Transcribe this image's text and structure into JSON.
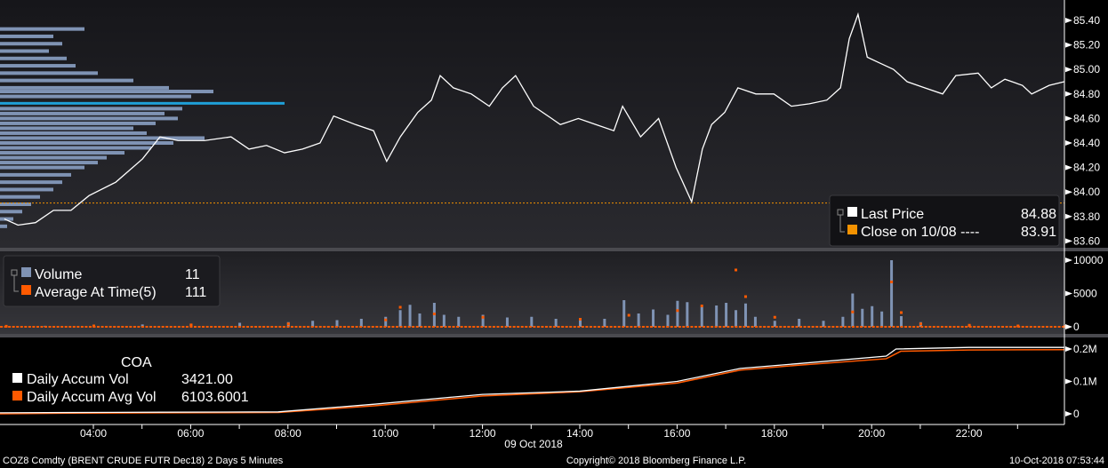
{
  "chart_data": [
    {
      "type": "line",
      "title": "Price",
      "yaxis_ticks": [
        "85.40",
        "85.20",
        "85.00",
        "84.80",
        "84.60",
        "84.40",
        "84.20",
        "84.00",
        "83.80",
        "83.60"
      ],
      "ylim": [
        83.55,
        85.57
      ],
      "legend": {
        "last_price_label": "Last Price",
        "last_price_value": "84.88",
        "close_label": "Close on 10/08 ----",
        "close_value": "83.91"
      },
      "close_line": 83.91,
      "volume_profile_peak": 84.72,
      "series": [
        {
          "name": "Last Price",
          "color": "#ffffff",
          "points": [
            [
              2.17,
              83.78
            ],
            [
              2.45,
              83.73
            ],
            [
              2.81,
              83.75
            ],
            [
              3.18,
              83.85
            ],
            [
              3.54,
              83.85
            ],
            [
              3.91,
              83.97
            ],
            [
              4.46,
              84.08
            ],
            [
              5.01,
              84.27
            ],
            [
              5.37,
              84.45
            ],
            [
              5.74,
              84.42
            ],
            [
              6.29,
              84.42
            ],
            [
              6.83,
              84.45
            ],
            [
              7.2,
              84.35
            ],
            [
              7.56,
              84.38
            ],
            [
              7.93,
              84.32
            ],
            [
              8.3,
              84.35
            ],
            [
              8.66,
              84.4
            ],
            [
              8.94,
              84.62
            ],
            [
              9.39,
              84.55
            ],
            [
              9.76,
              84.5
            ],
            [
              10.03,
              84.25
            ],
            [
              10.31,
              84.45
            ],
            [
              10.67,
              84.65
            ],
            [
              10.95,
              84.75
            ],
            [
              11.13,
              84.95
            ],
            [
              11.4,
              84.85
            ],
            [
              11.77,
              84.8
            ],
            [
              12.14,
              84.7
            ],
            [
              12.41,
              84.85
            ],
            [
              12.68,
              84.95
            ],
            [
              13.05,
              84.7
            ],
            [
              13.42,
              84.6
            ],
            [
              13.6,
              84.55
            ],
            [
              13.97,
              84.6
            ],
            [
              14.33,
              84.55
            ],
            [
              14.7,
              84.5
            ],
            [
              14.88,
              84.7
            ],
            [
              15.25,
              84.45
            ],
            [
              15.62,
              84.6
            ],
            [
              15.98,
              84.2
            ],
            [
              16.3,
              83.92
            ],
            [
              16.52,
              84.35
            ],
            [
              16.71,
              84.55
            ],
            [
              16.98,
              84.65
            ],
            [
              17.25,
              84.85
            ],
            [
              17.62,
              84.8
            ],
            [
              17.99,
              84.8
            ],
            [
              18.35,
              84.7
            ],
            [
              18.72,
              84.72
            ],
            [
              19.08,
              84.75
            ],
            [
              19.36,
              84.85
            ],
            [
              19.54,
              85.25
            ],
            [
              19.72,
              85.45
            ],
            [
              19.91,
              85.1
            ],
            [
              20.18,
              85.05
            ],
            [
              20.45,
              85.0
            ],
            [
              20.73,
              84.9
            ],
            [
              21.09,
              84.85
            ],
            [
              21.46,
              84.8
            ],
            [
              21.73,
              84.95
            ],
            [
              22.19,
              84.97
            ],
            [
              22.46,
              84.85
            ],
            [
              22.74,
              84.92
            ],
            [
              23.1,
              84.87
            ],
            [
              23.29,
              84.8
            ],
            [
              23.65,
              84.87
            ],
            [
              23.96,
              84.9
            ]
          ]
        }
      ],
      "volume_profile": [
        [
          85.33,
          95
        ],
        [
          85.27,
          60
        ],
        [
          85.21,
          70
        ],
        [
          85.15,
          55
        ],
        [
          85.09,
          75
        ],
        [
          85.03,
          85
        ],
        [
          84.97,
          110
        ],
        [
          84.91,
          150
        ],
        [
          84.85,
          190
        ],
        [
          84.82,
          240
        ],
        [
          84.78,
          215
        ],
        [
          84.72,
          320
        ],
        [
          84.68,
          205
        ],
        [
          84.64,
          185
        ],
        [
          84.6,
          200
        ],
        [
          84.56,
          175
        ],
        [
          84.52,
          150
        ],
        [
          84.48,
          165
        ],
        [
          84.44,
          230
        ],
        [
          84.4,
          195
        ],
        [
          84.36,
          170
        ],
        [
          84.32,
          140
        ],
        [
          84.28,
          120
        ],
        [
          84.24,
          110
        ],
        [
          84.2,
          95
        ],
        [
          84.14,
          80
        ],
        [
          84.08,
          70
        ],
        [
          84.02,
          60
        ],
        [
          83.96,
          45
        ],
        [
          83.9,
          35
        ],
        [
          83.84,
          25
        ],
        [
          83.78,
          15
        ],
        [
          83.72,
          8
        ]
      ]
    },
    {
      "type": "bar",
      "title": "Volume",
      "yaxis_ticks": [
        "10000",
        "5000",
        "0"
      ],
      "ylim": [
        0,
        10000
      ],
      "legend": {
        "volume_label": "Volume",
        "volume_value": "11",
        "avg_label": "Average At Time(5)",
        "avg_value": "111"
      },
      "series": [
        {
          "name": "Volume",
          "color": "#7f93b4",
          "points": [
            [
              2.2,
              100
            ],
            [
              3,
              150
            ],
            [
              4,
              300
            ],
            [
              5,
              350
            ],
            [
              6,
              450
            ],
            [
              7,
              600
            ],
            [
              8,
              700
            ],
            [
              8.5,
              900
            ],
            [
              9,
              1000
            ],
            [
              9.5,
              1200
            ],
            [
              10,
              1500
            ],
            [
              10.3,
              2500
            ],
            [
              10.5,
              3300
            ],
            [
              10.7,
              2000
            ],
            [
              11,
              3600
            ],
            [
              11.2,
              1800
            ],
            [
              11.5,
              1500
            ],
            [
              12,
              1800
            ],
            [
              12.5,
              1400
            ],
            [
              13,
              1500
            ],
            [
              13.5,
              1200
            ],
            [
              14,
              1100
            ],
            [
              14.5,
              1200
            ],
            [
              14.9,
              4000
            ],
            [
              15.2,
              2000
            ],
            [
              15.5,
              2600
            ],
            [
              15.8,
              1800
            ],
            [
              16,
              3900
            ],
            [
              16.2,
              3700
            ],
            [
              16.5,
              3000
            ],
            [
              16.8,
              3200
            ],
            [
              17,
              3600
            ],
            [
              17.2,
              2500
            ],
            [
              17.4,
              3500
            ],
            [
              17.6,
              1500
            ],
            [
              18,
              900
            ],
            [
              18.5,
              1200
            ],
            [
              19,
              900
            ],
            [
              19.4,
              1500
            ],
            [
              19.6,
              5000
            ],
            [
              19.8,
              2700
            ],
            [
              20,
              3100
            ],
            [
              20.2,
              2300
            ],
            [
              20.4,
              10000
            ],
            [
              20.6,
              1600
            ],
            [
              21,
              700
            ],
            [
              22,
              300
            ],
            [
              23,
              200
            ],
            [
              23.96,
              11
            ]
          ]
        },
        {
          "name": "Average At Time(5)",
          "color": "#ff5a00",
          "points": [
            [
              2.2,
              150
            ],
            [
              4,
              200
            ],
            [
              6,
              350
            ],
            [
              8,
              500
            ],
            [
              10,
              1100
            ],
            [
              10.3,
              3000
            ],
            [
              11,
              2000
            ],
            [
              12,
              1500
            ],
            [
              14,
              1200
            ],
            [
              15,
              1800
            ],
            [
              16,
              2500
            ],
            [
              16.5,
              3200
            ],
            [
              17.2,
              8600
            ],
            [
              17.4,
              4600
            ],
            [
              18,
              1500
            ],
            [
              19.6,
              2300
            ],
            [
              20.4,
              6800
            ],
            [
              20.6,
              2200
            ],
            [
              21,
              500
            ],
            [
              22,
              300
            ],
            [
              23,
              200
            ],
            [
              23.96,
              111
            ]
          ]
        }
      ]
    },
    {
      "type": "line",
      "title": "COA",
      "yaxis_ticks": [
        "0.2M",
        "0.1M",
        "0"
      ],
      "ylim": [
        0,
        0.2
      ],
      "legend": {
        "vol_label": "Daily Accum Vol",
        "vol_value": "3421.00",
        "avg_label": "Daily Accum Avg Vol",
        "avg_value": "6103.6001"
      },
      "series": [
        {
          "name": "Daily Accum Vol",
          "color": "#ffffff",
          "points": [
            [
              2.08,
              0.003
            ],
            [
              3.5,
              0.004
            ],
            [
              5.4,
              0.005
            ],
            [
              7.8,
              0.006
            ],
            [
              9.8,
              0.03
            ],
            [
              12,
              0.06
            ],
            [
              14,
              0.07
            ],
            [
              16,
              0.1
            ],
            [
              17.3,
              0.14
            ],
            [
              18.5,
              0.155
            ],
            [
              20.3,
              0.178
            ],
            [
              20.5,
              0.2
            ],
            [
              22,
              0.205
            ],
            [
              23.96,
              0.205
            ]
          ]
        },
        {
          "name": "Daily Accum Avg Vol",
          "color": "#ff5a00",
          "points": [
            [
              2.08,
              0.0
            ],
            [
              3.5,
              0.002
            ],
            [
              5.4,
              0.003
            ],
            [
              7.8,
              0.004
            ],
            [
              9.8,
              0.025
            ],
            [
              12,
              0.055
            ],
            [
              14,
              0.068
            ],
            [
              16,
              0.095
            ],
            [
              17.3,
              0.135
            ],
            [
              18.5,
              0.15
            ],
            [
              20.3,
              0.17
            ],
            [
              20.6,
              0.193
            ],
            [
              22,
              0.197
            ],
            [
              23.96,
              0.198
            ]
          ]
        }
      ]
    }
  ],
  "xaxis": {
    "ticks": [
      [
        "04:00",
        4
      ],
      [
        "06:00",
        6
      ],
      [
        "08:00",
        8
      ],
      [
        "10:00",
        10
      ],
      [
        "12:00",
        12
      ],
      [
        "14:00",
        14
      ],
      [
        "16:00",
        16
      ],
      [
        "18:00",
        18
      ],
      [
        "20:00",
        20
      ],
      [
        "22:00",
        22
      ]
    ],
    "date_label": "09 Oct 2018"
  },
  "footer": {
    "security": "COZ8 Comdty (BRENT CRUDE FUTR  Dec18) 2 Days 5 Minutes",
    "copyright": "Copyright© 2018 Bloomberg Finance L.P.",
    "timestamp": "10-Oct-2018 07:53:44"
  }
}
